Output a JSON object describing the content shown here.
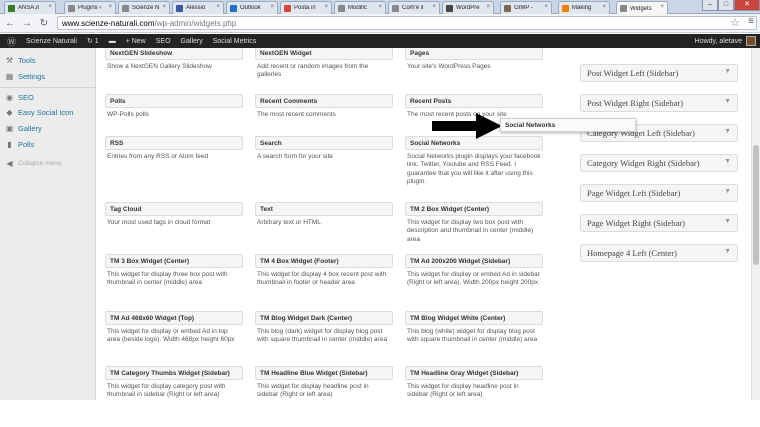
{
  "tabs": [
    {
      "label": "ANSA.it",
      "color": "#3a7a2f"
    },
    {
      "label": "Plugins ‹",
      "color": "#888888"
    },
    {
      "label": "Scienze N",
      "color": "#888888"
    },
    {
      "label": "Alessio",
      "color": "#3b5998"
    },
    {
      "label": "Outlook",
      "color": "#1f6fc5"
    },
    {
      "label": "Posta in",
      "color": "#d44638"
    },
    {
      "label": "Modific",
      "color": "#888888"
    },
    {
      "label": "Com'è il",
      "color": "#888888"
    },
    {
      "label": "WordPre",
      "color": "#464646"
    },
    {
      "label": "GIMP -",
      "color": "#7a6a4f"
    },
    {
      "label": "Making",
      "color": "#f57d00"
    },
    {
      "label": "Widgets",
      "color": "#888888"
    }
  ],
  "window_controls": {
    "minimize": "–",
    "maximize": "□",
    "close": "✕"
  },
  "address": {
    "host": "www.scienze-naturali.com",
    "path": "/wp-admin/widgets.php"
  },
  "adminbar": {
    "site": "Scienze Naturali",
    "updates": "1",
    "new": "+ New",
    "seo": "SEO",
    "gallery": "Gallery",
    "metrics": "Social Metrics",
    "howdy": "Howdy, aletave"
  },
  "sidebar_menu": [
    {
      "label": "Tools",
      "icon": "wrench-icon",
      "glyph": "⚒"
    },
    {
      "label": "Settings",
      "icon": "settings-icon",
      "glyph": "▦"
    },
    {
      "label": "SEO",
      "icon": "seo-icon",
      "glyph": "◉"
    },
    {
      "label": "Easy Social Icon",
      "icon": "social-icon",
      "glyph": "◆"
    },
    {
      "label": "Gallery",
      "icon": "gallery-icon",
      "glyph": "▣"
    },
    {
      "label": "Polls",
      "icon": "polls-icon",
      "glyph": "▮"
    },
    {
      "label": "Collapse menu",
      "icon": "collapse-icon",
      "glyph": "◀"
    }
  ],
  "widgets": [
    {
      "title": "NextGEN Slideshow",
      "desc": "Show a NextGEN Gallery Slideshow"
    },
    {
      "title": "NextGEN Widget",
      "desc": "Add recent or random images from the galleries"
    },
    {
      "title": "Pages",
      "desc": "Your site's WordPress Pages"
    },
    {
      "title": "Polls",
      "desc": "WP-Polls polls"
    },
    {
      "title": "Recent Comments",
      "desc": "The most recent comments"
    },
    {
      "title": "Recent Posts",
      "desc": "The most recent posts on your site"
    },
    {
      "title": "RSS",
      "desc": "Entries from any RSS or Atom feed"
    },
    {
      "title": "Search",
      "desc": "A search form for your site"
    },
    {
      "title": "Social Networks",
      "desc": "Social Networks plugin displays your facebook link, Twitter, Youtube and RSS Feed. I guarantee that you will like it after using this plugin."
    },
    {
      "title": "Tag Cloud",
      "desc": "Your most used tags in cloud format"
    },
    {
      "title": "Text",
      "desc": "Arbitrary text or HTML"
    },
    {
      "title": "TM 2 Box Widget (Center)",
      "desc": "This widget for display two box post with description and thumbnail in center (middle) area"
    },
    {
      "title": "TM 3 Box Widget (Center)",
      "desc": "This widget for display three box post with thumbnail in center (middle) area"
    },
    {
      "title": "TM 4 Box Widget (Footer)",
      "desc": "This widget for display 4 box recent post with thumbnail in footer or header area"
    },
    {
      "title": "TM Ad 200x200 Widget (Sidebar)",
      "desc": "This widget for display or embed Ad in sidebar (Right or left area). Width 200px height 200px"
    },
    {
      "title": "TM Ad 468x60 Widget (Top)",
      "desc": "This widget for display or embed Ad in top area (beside logo). Width 468px height 60px"
    },
    {
      "title": "TM Blog Widget Dark (Center)",
      "desc": "This blog (dark) widget for display blog post with square thumbnail in center (middle) area"
    },
    {
      "title": "TM Blog Widget White (Center)",
      "desc": "This blog (white) widget for display blog post with square thumbnail in center (middle) area"
    },
    {
      "title": "TM Category Thumbs Widget (Sidebar)",
      "desc": "This widget for display category post with thumbnail in sidebar (Right or left area)"
    },
    {
      "title": "TM Headline Blue Widget (Sidebar)",
      "desc": "This widget for display headline post in sidebar (Right or left area)"
    },
    {
      "title": "TM Headline Gray Widget (Sidebar)",
      "desc": "This widget for display headline post in sidebar (Right or left area)"
    }
  ],
  "dragged_widget": "Social Networks",
  "sidebars": [
    "Post Widget Left (Sidebar)",
    "Post Widget Right (Sidebar)",
    "Category Widget Left (Sidebar)",
    "Category Widget Right (Sidebar)",
    "Page Widget Left (Sidebar)",
    "Page Widget Right (Sidebar)",
    "Homepage 4 Left (Center)"
  ],
  "sidebar_arrow": "▼",
  "colors": {
    "adminbar": "#232323",
    "link": "#21759b"
  }
}
